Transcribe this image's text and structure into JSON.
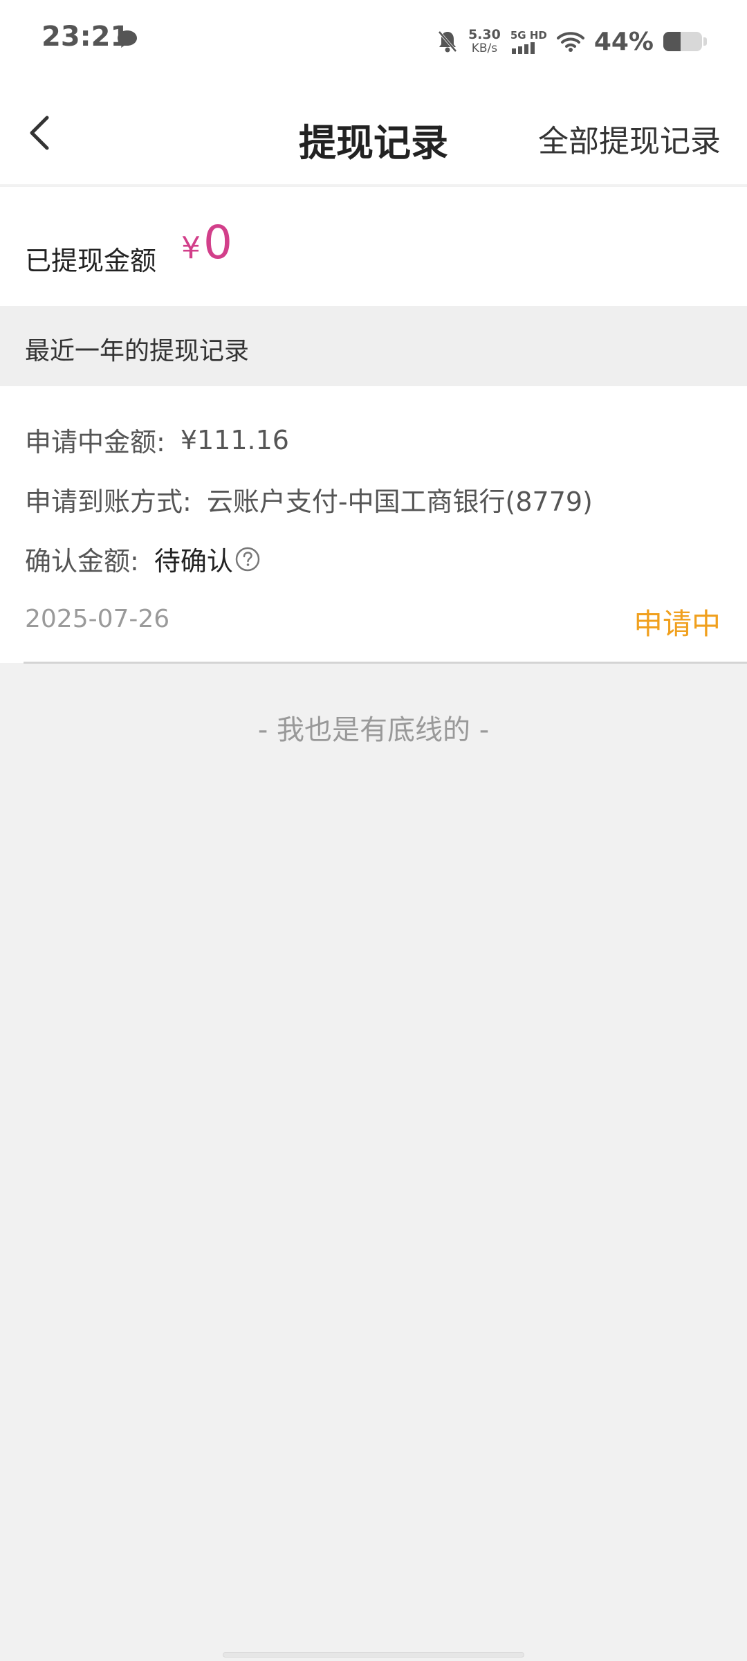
{
  "status_bar": {
    "time": "23:21",
    "net_speed": "5.30",
    "net_unit": "KB/s",
    "signal_label": "5G HD",
    "battery_percent": "44%",
    "battery_level": 0.44
  },
  "nav": {
    "title": "提现记录",
    "right_action": "全部提现记录"
  },
  "summary": {
    "label": "已提现金额",
    "currency": "¥",
    "amount": "0",
    "accent_color": "#d23f8a"
  },
  "section": {
    "title": "最近一年的提现记录"
  },
  "record": {
    "pending_label": "申请中金额:",
    "pending_value": "¥111.16",
    "method_label": "申请到账方式:",
    "method_value": "云账户支付-中国工商银行(8779)",
    "confirm_label": "确认金额:",
    "confirm_value": "待确认",
    "date": "2025-07-26",
    "status": "申请中",
    "status_color": "#f0a01e"
  },
  "footer": {
    "note": "- 我也是有底线的 -"
  }
}
